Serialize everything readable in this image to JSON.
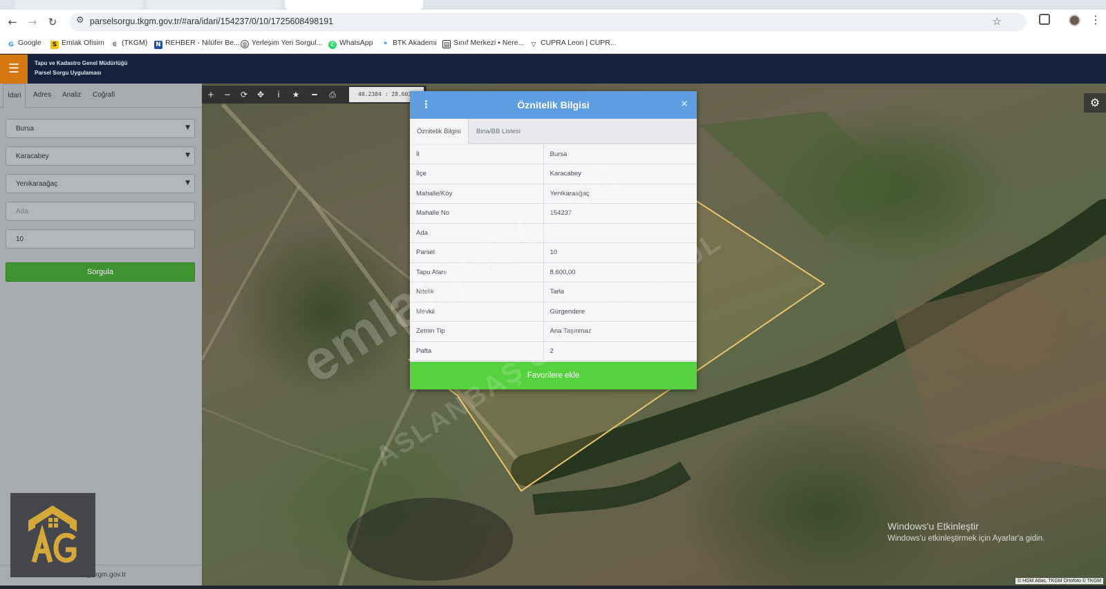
{
  "browser": {
    "url": "parselsorgu.tkgm.gov.tr/#ara/idari/154237/0/10/1725608498191",
    "bookmarks": [
      {
        "label": "Google",
        "icon": "google-icon"
      },
      {
        "label": "Emlak Ofisim",
        "icon": "s-logo-icon"
      },
      {
        "label": "(TKGM)",
        "icon": "tkgm-icon"
      },
      {
        "label": "REHBER - Nilüfer Be...",
        "icon": "n-logo-icon"
      },
      {
        "label": "Yerleşim Yeri Sorgul...",
        "icon": "gov-icon"
      },
      {
        "label": "WhatsApp",
        "icon": "whatsapp-icon"
      },
      {
        "label": "BTK Akademi",
        "icon": "btk-icon"
      },
      {
        "label": "Sınıf Merkezi • Nere...",
        "icon": "classroom-icon"
      },
      {
        "label": "CUPRA Leon | CUPR...",
        "icon": "cupra-icon"
      }
    ]
  },
  "header": {
    "org": "Tapu ve Kadastro Genel Müdürlüğü",
    "app": "Parsel Sorgu Uygulaması"
  },
  "sidebar": {
    "tabs": [
      "İdari",
      "Adres",
      "Analiz",
      "Coğrafi"
    ],
    "active_tab": "İdari",
    "province": "Bursa",
    "district": "Karacabey",
    "neighborhood": "Yenikaraağaç",
    "ada_placeholder": "Ada",
    "parsel": "10",
    "query_button": "Sorgula",
    "footer_email": "cbs@tkgm.gov.tr"
  },
  "map": {
    "coords": "40.2384 : 28.6030",
    "attribution": "© HGM Atlas, TKGM Ortofoto © TKGM",
    "windows_activation_title": "Windows'u Etkinleştir",
    "windows_activation_text": "Windows'u etkinleştirmek için Ayarlar'a gidin."
  },
  "popup": {
    "title": "Öznitelik Bilgisi",
    "tabs": [
      "Öznitelik Bilgisi",
      "Bina/BB Listesi"
    ],
    "rows": [
      {
        "key": "İl",
        "value": "Bursa"
      },
      {
        "key": "İlçe",
        "value": "Karacabey"
      },
      {
        "key": "Mahalle/Köy",
        "value": "Yenikaraağaç"
      },
      {
        "key": "Mahalle No",
        "value": "154237"
      },
      {
        "key": "Ada",
        "value": ""
      },
      {
        "key": "Parsel",
        "value": "10"
      },
      {
        "key": "Tapu Alanı",
        "value": "8.600,00"
      },
      {
        "key": "Nitelik",
        "value": "Tarla"
      },
      {
        "key": "Mevkii",
        "value": "Gürgendere"
      },
      {
        "key": "Zemin Tip",
        "value": "Ana Taşınmaz"
      },
      {
        "key": "Pafta",
        "value": "2"
      }
    ],
    "favorite_button": "Favorilere ekle"
  },
  "watermark": {
    "main": "emlakjet.com",
    "secondary": "ASLANBAŞ GAYRİMENKUL"
  },
  "colors": {
    "header_bg": "#14213b",
    "menu_orange": "#d77711",
    "popup_header": "#5e9de0",
    "favorite_green": "#58d140",
    "query_green": "#3e9331",
    "parcel_outline": "#e8c56e"
  }
}
